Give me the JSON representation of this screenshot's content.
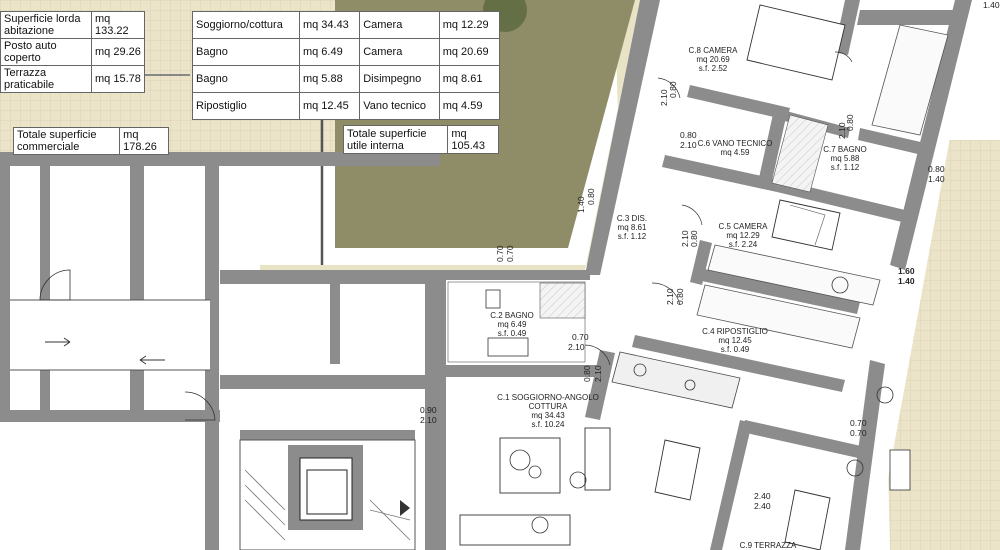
{
  "table_lordo": [
    {
      "label": "Superficie lorda abitazione",
      "value": "mq 133.22"
    },
    {
      "label": "Posto auto coperto",
      "value": "mq 29.26"
    },
    {
      "label": "Terrazza praticabile",
      "value": "mq 15.78"
    }
  ],
  "table_vani": [
    {
      "a": "Soggiorno/cottura",
      "av": "mq 34.43",
      "b": "Camera",
      "bv": "mq 12.29"
    },
    {
      "a": "Bagno",
      "av": "mq 6.49",
      "b": "Camera",
      "bv": "mq 20.69"
    },
    {
      "a": "Bagno",
      "av": "mq 5.88",
      "b": "Disimpegno",
      "bv": "mq 8.61"
    },
    {
      "a": "Ripostiglio",
      "av": "mq 12.45",
      "b": "Vano tecnico",
      "bv": "mq 4.59"
    }
  ],
  "totale_commerciale": {
    "label": "Totale superficie commerciale",
    "value": "mq 178.26"
  },
  "totale_utile": {
    "label": "Totale superficie utile interna",
    "value": "mq 105.43"
  },
  "rooms": {
    "c8": [
      "C.8 CAMERA",
      "mq 20.69",
      "s.f. 2.52"
    ],
    "c6": [
      "C.6 VANO TECNICO",
      "mq 4.59"
    ],
    "c7": [
      "C.7 BAGNO",
      "mq 5.88",
      "s.f. 1.12"
    ],
    "c3": [
      "C.3 DIS.",
      "mq 8.61",
      "s.f. 1.12"
    ],
    "c5": [
      "C.5 CAMERA",
      "mq 12.29",
      "s.f. 2.24"
    ],
    "c2": [
      "C.2 BAGNO",
      "mq 6.49",
      "s.f. 0.49"
    ],
    "c4": [
      "C.4 RIPOSTIGLIO",
      "mq 12.45",
      "s.f. 0.49"
    ],
    "c1": [
      "C.1 SOGGIORNO-ANGOLO",
      "COTTURA",
      "mq 34.43",
      "s.f. 10.24"
    ],
    "c9": [
      "C.9 TERRAZZA"
    ]
  },
  "dims": {
    "d_top": [
      "1.40"
    ],
    "d1": [
      "0.80",
      "2.10"
    ],
    "d2": [
      "0.80",
      "2.10"
    ],
    "d3": [
      "0.80",
      "1.40"
    ],
    "d4": [
      "0.80",
      "2.10"
    ],
    "d5": [
      "0.80",
      "1.40"
    ],
    "d6": [
      "0.70",
      "0.70"
    ],
    "d7": [
      "1.60",
      "1.40"
    ],
    "d8": [
      "0.80",
      "2.10"
    ],
    "d9": [
      "0.80",
      "2.10"
    ],
    "d10": [
      "0.70",
      "2.10"
    ],
    "d11": [
      "0.80",
      "2.10"
    ],
    "d12": [
      "0.90",
      "2.10"
    ],
    "d13": [
      "0.70",
      "0.70"
    ],
    "d14": [
      "2.40",
      "2.40"
    ]
  }
}
